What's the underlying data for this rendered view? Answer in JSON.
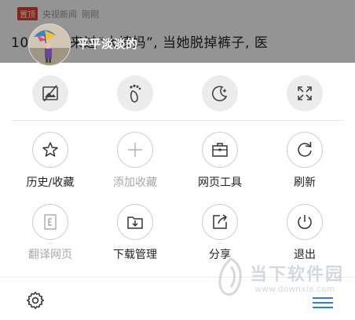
{
  "news": {
    "hot_tag": "置顶",
    "source": "央视新闻",
    "time": "刚刚",
    "title": "10岁女孩来过“大姨妈”, 当她脱掉裤子, 医"
  },
  "user": {
    "name": "平平淡淡的"
  },
  "mode_buttons": [
    {
      "icon": "no-image-icon"
    },
    {
      "icon": "footprint-icon"
    },
    {
      "icon": "night-mode-icon"
    },
    {
      "icon": "fullscreen-icon"
    }
  ],
  "menu": {
    "history": "历史/收藏",
    "add_bookmark": "添加收藏",
    "page_tools": "网页工具",
    "refresh": "刷新",
    "translate": "翻译网页",
    "downloads": "下载管理",
    "share": "分享",
    "exit": "退出"
  },
  "watermark": {
    "text": "当下软件园",
    "url": "www.downxia.com"
  },
  "colors": {
    "hot_tag": "#e8412f",
    "dim_overlay": "rgba(0,0,0,0.42)",
    "disabled_text": "#a8a8a8"
  }
}
